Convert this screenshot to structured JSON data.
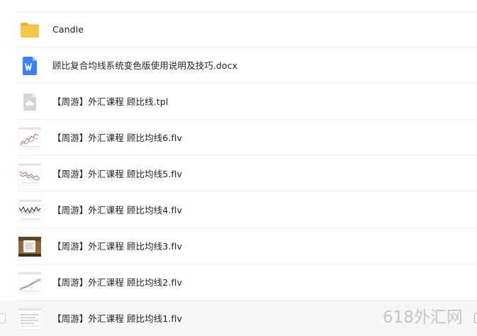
{
  "files": [
    {
      "name": "Candle",
      "icon": "folder-icon",
      "type": "folder"
    },
    {
      "name": "顾比复合均线系统变色版使用说明及技巧.docx",
      "icon": "word-doc-icon",
      "type": "docx"
    },
    {
      "name": "【周游】外汇课程 顾比线.tpl",
      "icon": "cloud-file-icon",
      "type": "tpl"
    },
    {
      "name": "【周游】外汇课程 顾比均线6.flv",
      "icon": "video-thumbnail",
      "type": "flv"
    },
    {
      "name": "【周游】外汇课程 顾比均线5.flv",
      "icon": "video-thumbnail",
      "type": "flv"
    },
    {
      "name": "【周游】外汇课程 顾比均线4.flv",
      "icon": "video-thumbnail",
      "type": "flv"
    },
    {
      "name": "【周游】外汇课程 顾比均线3.flv",
      "icon": "video-thumbnail",
      "type": "flv"
    },
    {
      "name": "【周游】外汇课程 顾比均线2.flv",
      "icon": "video-thumbnail",
      "type": "flv"
    },
    {
      "name": "【周游】外汇课程 顾比均线1.flv",
      "icon": "video-thumbnail",
      "type": "flv",
      "selected": true
    }
  ],
  "watermark": "618外汇网",
  "colors": {
    "folder": "#f7c547",
    "word": "#3b82f6",
    "cloud_file": "#c9ccd1",
    "selected_row": "#f5f6f8",
    "divider": "#eef0f3",
    "watermark": "#c6c6c6"
  }
}
